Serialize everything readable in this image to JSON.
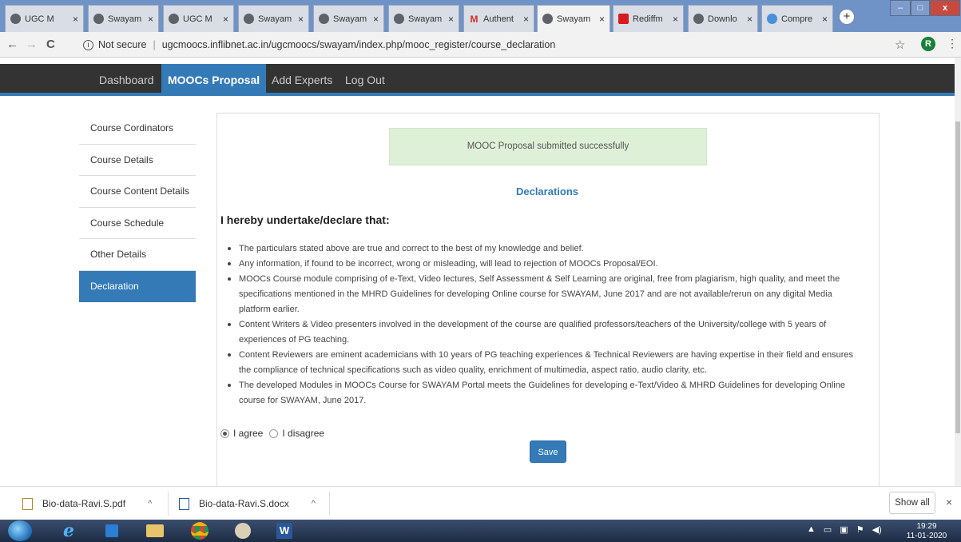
{
  "browser": {
    "tabs": [
      {
        "label": "UGC M",
        "icon": "globe-icon"
      },
      {
        "label": "Swayam",
        "icon": "globe-icon"
      },
      {
        "label": "UGC M",
        "icon": "globe-icon"
      },
      {
        "label": "Swayam",
        "icon": "globe-icon"
      },
      {
        "label": "Swayam",
        "icon": "globe-icon"
      },
      {
        "label": "Swayam",
        "icon": "globe-icon"
      },
      {
        "label": "Authent",
        "icon": "gmail-icon"
      },
      {
        "label": "Swayam",
        "icon": "globe-icon",
        "active": true
      },
      {
        "label": "Rediffm",
        "icon": "rediff-icon"
      },
      {
        "label": "Downlo",
        "icon": "globe-icon"
      },
      {
        "label": "Compre",
        "icon": "compress-icon"
      }
    ],
    "tab_close_glyph": "×",
    "new_tab_glyph": "+",
    "window_controls": {
      "minimize": "–",
      "maximize": "□",
      "close": "x"
    },
    "nav": {
      "back": "←",
      "forward": "→",
      "reload": "C"
    },
    "info_glyph": "i",
    "security_label": "Not secure",
    "url": "ugcmoocs.inflibnet.ac.in/ugcmoocs/swayam/index.php/mooc_register/course_declaration",
    "star_glyph": "☆",
    "profile_initial": "R",
    "menu_glyph": "⋮"
  },
  "site_nav": {
    "items": [
      "Dashboard",
      "MOOCs Proposal",
      "Add Experts",
      "Log Out"
    ],
    "active": "MOOCs Proposal"
  },
  "sidebar": {
    "items": [
      "Course Cordinators",
      "Course Details",
      "Course Content Details",
      "Course Schedule",
      "Other Details",
      "Declaration"
    ],
    "active": "Declaration"
  },
  "main": {
    "alert": "MOOC Proposal submitted successfully",
    "title": "Declarations",
    "heading": "I hereby undertake/declare that:",
    "declarations": [
      "The particulars stated above are true and correct to the best of my knowledge and belief.",
      "Any information, if found to be incorrect, wrong or misleading, will lead to rejection of MOOCs Proposal/EOI.",
      "MOOCs Course module comprising of e-Text, Video lectures, Self Assessment & Self Learning are original, free from plagiarism, high quality, and meet the specifications mentioned in the MHRD Guidelines for developing Online course for SWAYAM, June 2017 and are not available/rerun on any digital Media platform earlier.",
      "Content Writers & Video presenters involved in the development of the course are qualified professors/teachers of the University/college with 5 years of experiences of PG teaching.",
      "Content Reviewers are eminent academicians with 10 years of PG teaching experiences & Technical Reviewers are having expertise in their field and ensures the compliance of technical specifications such as video quality, enrichment of multimedia, aspect ratio, audio clarity, etc.",
      "The developed Modules in MOOCs Course for SWAYAM Portal meets the Guidelines for developing e-Text/Video & MHRD Guidelines for developing Online course for SWAYAM, June 2017."
    ],
    "agree_label": "I agree",
    "disagree_label": "I disagree",
    "agree_selected": true,
    "save_label": "Save"
  },
  "downloads": {
    "files": [
      {
        "name": "Bio-data-Ravi.S.pdf",
        "icon": "pdf-file-icon"
      },
      {
        "name": "Bio-data-Ravi.S.docx",
        "icon": "word-file-icon"
      }
    ],
    "caret_glyph": "^",
    "show_all_label": "Show all",
    "close_glyph": "×"
  },
  "taskbar": {
    "apps": [
      "start-icon",
      "ie-icon",
      "media-player-icon",
      "explorer-icon",
      "chrome-icon",
      "paint-icon",
      "word-icon"
    ],
    "tray_glyphs": [
      "▲",
      "▭",
      "▣",
      "⚑",
      "◀)"
    ],
    "time": "19:29",
    "date": "11-01-2020"
  },
  "colors": {
    "accent": "#337ab7",
    "nav_bg": "#333333",
    "alert_bg": "#dff0d8",
    "titlebar": "#6f93c6",
    "close_button": "#c94a3c"
  }
}
